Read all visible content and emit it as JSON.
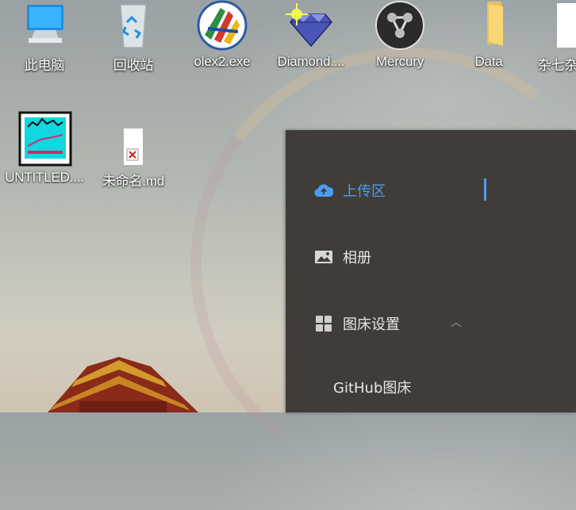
{
  "desktop": {
    "icons": [
      {
        "label": "此电脑",
        "icon": "computer-icon"
      },
      {
        "label": "回收站",
        "icon": "recycle-bin-icon"
      },
      {
        "label": "olex2.exe",
        "icon": "olex2-icon"
      },
      {
        "label": "Diamond....",
        "icon": "diamond-icon"
      },
      {
        "label": "Mercury",
        "icon": "mercury-icon"
      },
      {
        "label": "Data",
        "icon": "folder-icon"
      },
      {
        "label": "杂七杂",
        "icon": "file-icon"
      },
      {
        "label": "UNTITLED....",
        "icon": "plot-app-icon"
      },
      {
        "label": "未命名.md",
        "icon": "markdown-file-icon"
      }
    ]
  },
  "sidebar": {
    "items": [
      {
        "label": "上传区",
        "icon": "cloud-upload-icon",
        "active": true
      },
      {
        "label": "相册",
        "icon": "image-icon",
        "active": false
      },
      {
        "label": "图床设置",
        "icon": "grid-icon",
        "active": false,
        "expanded": true
      },
      {
        "label": "GitHub图床",
        "icon": "",
        "active": false
      }
    ],
    "accent_color": "#4a9ef0",
    "background_color": "#403d39"
  }
}
